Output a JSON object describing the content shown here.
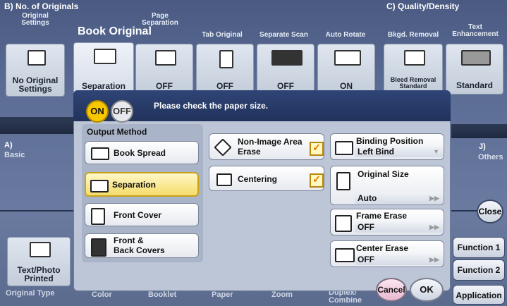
{
  "header": {
    "originals_section": "B)  No. of Originals",
    "quality_section": "C)  Quality/Density"
  },
  "top_tabs": [
    {
      "label": "Original\nSettings",
      "value": "No Original\nSettings"
    },
    {
      "label": "Book Original",
      "value": "Separation"
    },
    {
      "label": "Page\nSeparation",
      "value": "OFF"
    },
    {
      "label": "Tab Original",
      "value": "OFF"
    },
    {
      "label": "Separate Scan",
      "value": "OFF"
    },
    {
      "label": "Auto Rotate",
      "value": "ON"
    },
    {
      "label": "Bkgd. Removal",
      "value": "Bleed Removal Standard"
    },
    {
      "label": "Text\nEnhancement",
      "value": "Standard"
    }
  ],
  "left_panel": {
    "section": "A)",
    "name": "Basic",
    "original_type": "Text/Photo\nPrinted",
    "original_type_label": "Original Type"
  },
  "right_panel": {
    "section": "J)",
    "name": "Others"
  },
  "bottom_labels": [
    "Color",
    "Booklet",
    "Paper",
    "Zoom",
    "Duplex/\nCombine"
  ],
  "side_buttons": {
    "close": "Close",
    "function1": "Function 1",
    "function2": "Function 2",
    "application": "Application"
  },
  "popup": {
    "title": "Book Original",
    "on": "ON",
    "off": "OFF",
    "message": "Please check the paper size.",
    "output_method_label": "Output Method",
    "output_methods": [
      "Book Spread",
      "Separation",
      "Front Cover",
      "Front &\nBack Covers"
    ],
    "selected_output": "Separation",
    "non_image_area_erase": "Non-Image Area\nErase",
    "centering": "Centering",
    "binding_position": {
      "label": "Binding Position",
      "value": "Left Bind"
    },
    "original_size": {
      "label": "Original Size",
      "value": "Auto"
    },
    "frame_erase": {
      "label": "Frame Erase",
      "value": "OFF"
    },
    "center_erase": {
      "label": "Center Erase",
      "value": "OFF"
    },
    "cancel": "Cancel",
    "ok": "OK"
  },
  "colors": {
    "selected": "#f5dc6a",
    "header_blue": "#21325b",
    "background": "#5b6b8e"
  }
}
